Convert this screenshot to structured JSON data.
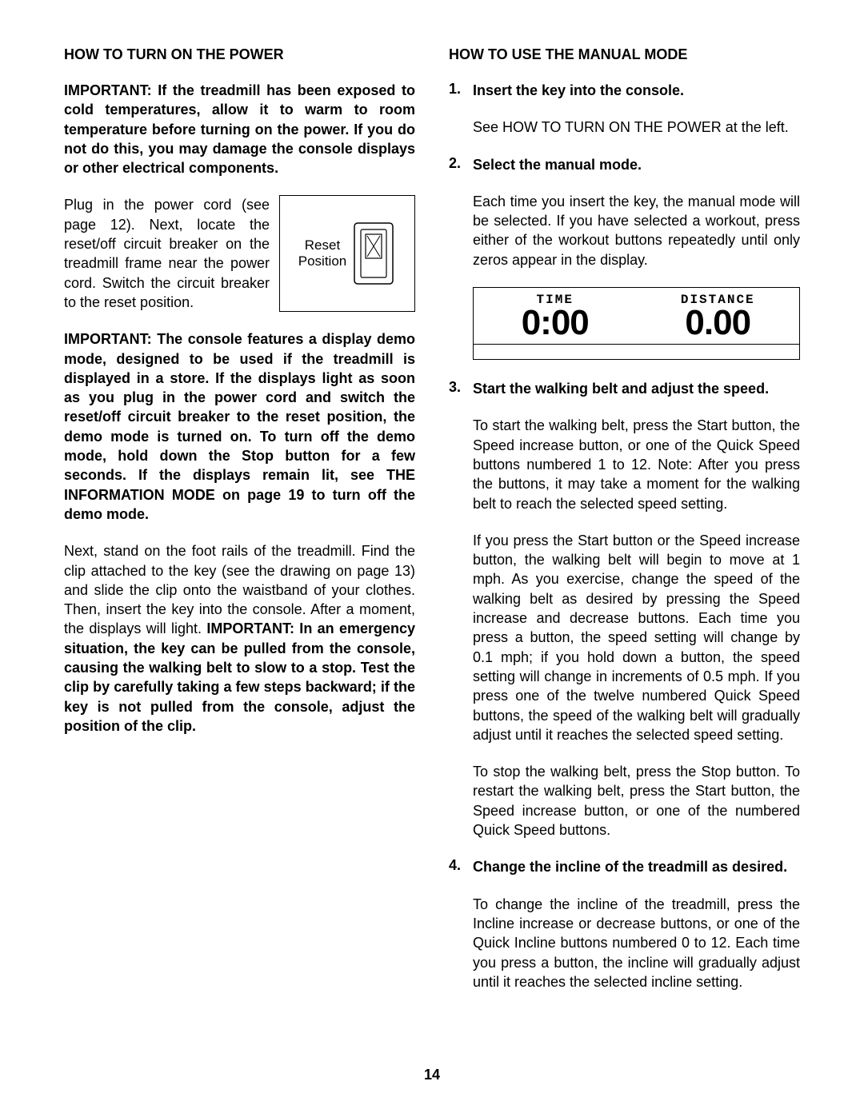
{
  "page_number": "14",
  "left": {
    "heading": "HOW TO TURN ON THE POWER",
    "p1": "IMPORTANT: If the treadmill has been exposed to cold temperatures, allow it to warm to room temperature before turning on the power. If you do not do this, you may damage the console displays or other electrical components.",
    "p2": "Plug in the power cord (see page 12). Next, locate the reset/off circuit breaker on the treadmill frame near the power cord. Switch the circuit breaker to the reset position.",
    "fig_label_line1": "Reset",
    "fig_label_line2": "Position",
    "p3": "IMPORTANT: The console features a display demo mode, designed to be used if the treadmill is displayed in a store. If the displays light as soon as you plug in the power cord and switch the reset/off circuit breaker to the reset position, the demo mode is turned on. To turn off the demo mode, hold down the Stop button for a few seconds. If the displays remain lit, see THE INFORMATION MODE on page 19 to turn off the demo mode.",
    "p4a": "Next, stand on the foot rails of the treadmill. Find the clip attached to the key (see the drawing on page 13) and slide the clip onto the waistband of your clothes. Then, insert the key into the console. After a moment, the displays will light. ",
    "p4b": "IMPORTANT: In an emergency situation, the key can be pulled from the console, causing the walking belt to slow to a stop. Test the clip by carefully taking a few steps backward; if the key is not pulled from the console, adjust the position of the clip."
  },
  "right": {
    "heading": "HOW TO USE THE MANUAL MODE",
    "steps": [
      {
        "title": "Insert the key into the console.",
        "body": [
          "See HOW TO TURN ON THE POWER at the left."
        ]
      },
      {
        "title": "Select the manual mode.",
        "body": [
          "Each time you insert the key, the manual mode will be selected. If you have selected a workout, press either of the workout buttons repeatedly until only zeros appear in the display."
        ]
      },
      {
        "title": "Start the walking belt and adjust the speed.",
        "body": [
          "To start the walking belt, press the Start button, the Speed increase button, or one of the Quick Speed buttons numbered 1 to 12. Note: After you press the buttons, it may take a moment for the walking belt to reach the selected speed setting.",
          "If you press the Start button or the Speed increase button, the walking belt will begin to move at 1 mph. As you exercise, change the speed of the walking belt as desired by pressing the Speed increase and decrease buttons. Each time you press a button, the speed setting will change by 0.1 mph; if you hold down a button, the speed setting will change in increments of 0.5 mph. If you press one of the twelve numbered Quick Speed buttons, the speed of the walking belt will gradually adjust until it reaches the selected speed setting.",
          "To stop the walking belt, press the Stop button. To restart the walking belt, press the Start button, the Speed increase button, or one of the numbered Quick Speed buttons."
        ]
      },
      {
        "title": "Change the incline of the treadmill as desired.",
        "body": [
          "To change the incline of the treadmill, press the Incline increase or decrease buttons, or one of the Quick Incline buttons numbered 0 to 12. Each time you press a button, the incline will gradually adjust until it reaches the selected incline setting."
        ]
      }
    ],
    "display": {
      "time_label": "TIME",
      "time_value": "0:00",
      "dist_label": "DISTANCE",
      "dist_value": "0.00"
    }
  }
}
